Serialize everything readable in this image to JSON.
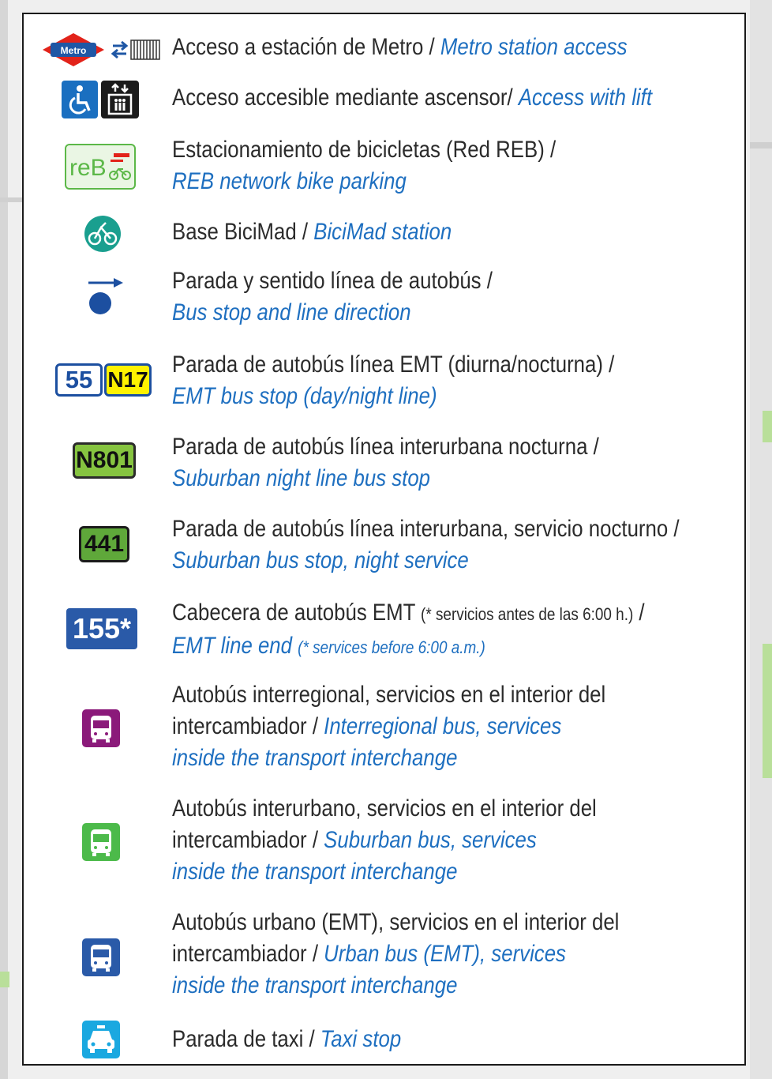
{
  "legend": {
    "metro": {
      "logo_text": "Metro",
      "es": "Acceso a estación de Metro / ",
      "en": "Metro station access"
    },
    "lift": {
      "es": "Acceso accesible mediante ascensor/ ",
      "en": "Access with lift"
    },
    "reb": {
      "logo_text": "reB",
      "es": "Estacionamiento de bicicletas (Red REB) /",
      "en": "REB network bike parking"
    },
    "bicimad": {
      "es": "Base BiciMad / ",
      "en": "BiciMad station"
    },
    "bus_stop": {
      "es": "Parada y sentido línea de autobús /",
      "en": "Bus stop and line direction"
    },
    "emt_stop": {
      "badge_day": "55",
      "badge_night": "N17",
      "es": "Parada de autobús línea EMT (diurna/nocturna) /",
      "en": "EMT bus stop (day/night line)"
    },
    "suburban_night": {
      "badge": "N801",
      "es": "Parada de autobús línea interurbana nocturna /",
      "en": "Suburban night line bus stop"
    },
    "suburban_night_service": {
      "badge": "441",
      "es": "Parada de autobús línea interurbana, servicio nocturno /",
      "en": "Suburban bus stop, night service"
    },
    "emt_line_end": {
      "badge": "155*",
      "es": "Cabecera de autobús EMT ",
      "es_note": "(* servicios antes de las 6:00 h.)",
      "es_tail": " /",
      "en": "EMT line end ",
      "en_note": "(* services before 6:00 a.m.)"
    },
    "interregional": {
      "es_line1": "Autobús interregional, servicios en el interior del",
      "es_line2": "intercambiador / ",
      "en_line2": "Interregional bus, services",
      "en_line3": "inside the transport interchange"
    },
    "interurban": {
      "es_line1": "Autobús interurbano, servicios en el interior del",
      "es_line2": "intercambiador / ",
      "en_line2": "Suburban bus, services",
      "en_line3": "inside the transport interchange"
    },
    "urban": {
      "es_line1": "Autobús urbano (EMT), servicios en el interior del",
      "es_line2": "intercambiador / ",
      "en_line2": "Urban bus (EMT), services",
      "en_line3": "inside the transport interchange"
    },
    "taxi": {
      "es": "Parada de taxi / ",
      "en": "Taxi stop"
    }
  },
  "colors": {
    "metro_red": "#e2231a",
    "metro_blue": "#1f57a5",
    "access_blue": "#1a6fc0",
    "reb_green": "#5cb848",
    "bicimad_teal": "#1a9f8f",
    "bus_blue": "#1c4fa0",
    "night_yellow": "#fff200",
    "suburban_green": "#86c440",
    "interregional_purple": "#8b1a7a",
    "interurban_green": "#4cba4a",
    "urban_blue": "#2a5aa8",
    "taxi_cyan": "#1aa8e0",
    "text_es": "#2b2b2b",
    "text_en": "#1e6fc0"
  }
}
